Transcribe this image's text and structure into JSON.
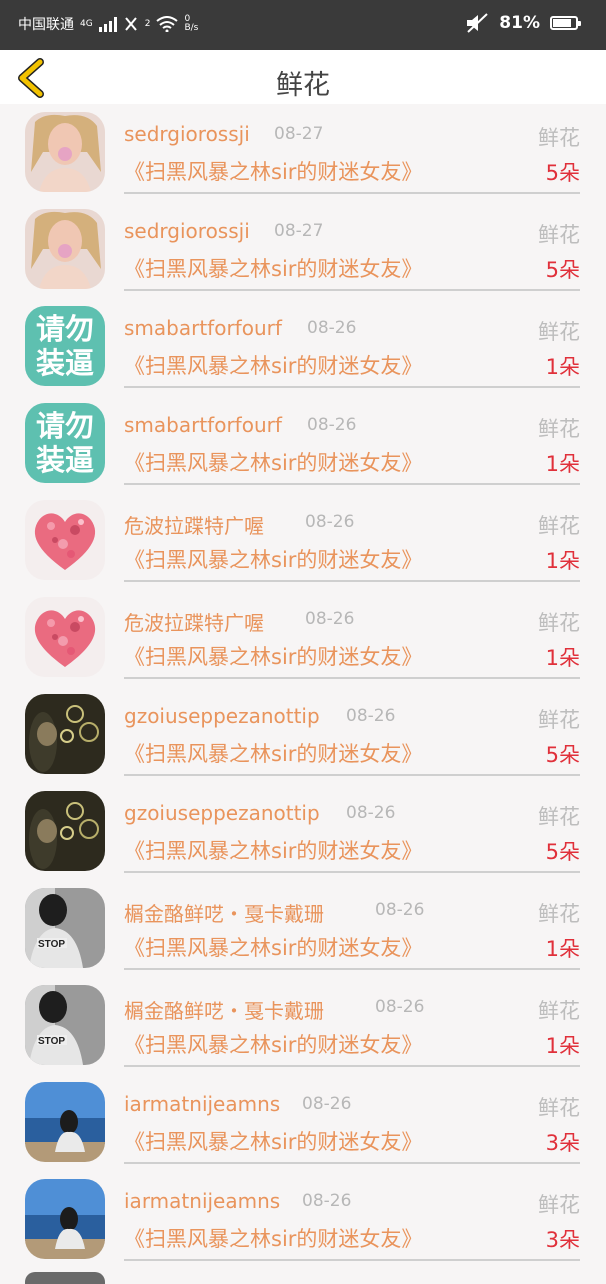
{
  "status_bar": {
    "carrier": "中国联通",
    "network": "4G",
    "sim_slot": "2",
    "speed_value": "0",
    "speed_unit": "B/s",
    "battery_percent": "81%",
    "battery_level": 0.81
  },
  "header": {
    "title": "鲜花",
    "back_icon": "chevron-left-icon"
  },
  "colors": {
    "name": "#e9945c",
    "count": "#e0303a",
    "back_icon": "#f2c200"
  },
  "rows": [
    {
      "name": "sedrgiorossji",
      "date": "08-27",
      "tag": "鲜花",
      "book": "《扫黑风暴之林sir的财迷女友》",
      "count": "5朵",
      "avatar": "photo-woman-bubblegum"
    },
    {
      "name": "sedrgiorossji",
      "date": "08-27",
      "tag": "鲜花",
      "book": "《扫黑风暴之林sir的财迷女友》",
      "count": "5朵",
      "avatar": "photo-woman-bubblegum"
    },
    {
      "name": "smabartforfourf",
      "date": "08-26",
      "tag": "鲜花",
      "book": "《扫黑风暴之林sir的财迷女友》",
      "count": "1朵",
      "avatar": "text-badge",
      "avatar_text": [
        "请勿",
        "装逼"
      ]
    },
    {
      "name": "smabartforfourf",
      "date": "08-26",
      "tag": "鲜花",
      "book": "《扫黑风暴之林sir的财迷女友》",
      "count": "1朵",
      "avatar": "text-badge",
      "avatar_text": [
        "请勿",
        "装逼"
      ]
    },
    {
      "name": "危波拉蹀特广喔",
      "date": "08-26",
      "tag": "鲜花",
      "book": "《扫黑风暴之林sir的财迷女友》",
      "count": "1朵",
      "avatar": "heart-petals"
    },
    {
      "name": "危波拉蹀特广喔",
      "date": "08-26",
      "tag": "鲜花",
      "book": "《扫黑风暴之林sir的财迷女友》",
      "count": "1朵",
      "avatar": "heart-petals"
    },
    {
      "name": "gzoiuseppezanottip",
      "date": "08-26",
      "tag": "鲜花",
      "book": "《扫黑风暴之林sir的财迷女友》",
      "count": "5朵",
      "avatar": "photo-smoke-rings"
    },
    {
      "name": "gzoiuseppezanottip",
      "date": "08-26",
      "tag": "鲜花",
      "book": "《扫黑风暴之林sir的财迷女友》",
      "count": "5朵",
      "avatar": "photo-smoke-rings"
    },
    {
      "name": "榍金酪鲜呓・戛卡戴珊",
      "date": "08-26",
      "tag": "鲜花",
      "book": "《扫黑风暴之林sir的财迷女友》",
      "count": "1朵",
      "avatar": "photo-bw-stop"
    },
    {
      "name": "榍金酪鲜呓・戛卡戴珊",
      "date": "08-26",
      "tag": "鲜花",
      "book": "《扫黑风暴之林sir的财迷女友》",
      "count": "1朵",
      "avatar": "photo-bw-stop"
    },
    {
      "name": "iarmatnijeamns",
      "date": "08-26",
      "tag": "鲜花",
      "book": "《扫黑风暴之林sir的财迷女友》",
      "count": "3朵",
      "avatar": "photo-sea-girl"
    },
    {
      "name": "iarmatnijeamns",
      "date": "08-26",
      "tag": "鲜花",
      "book": "《扫黑风暴之林sir的财迷女友》",
      "count": "3朵",
      "avatar": "photo-sea-girl"
    }
  ]
}
